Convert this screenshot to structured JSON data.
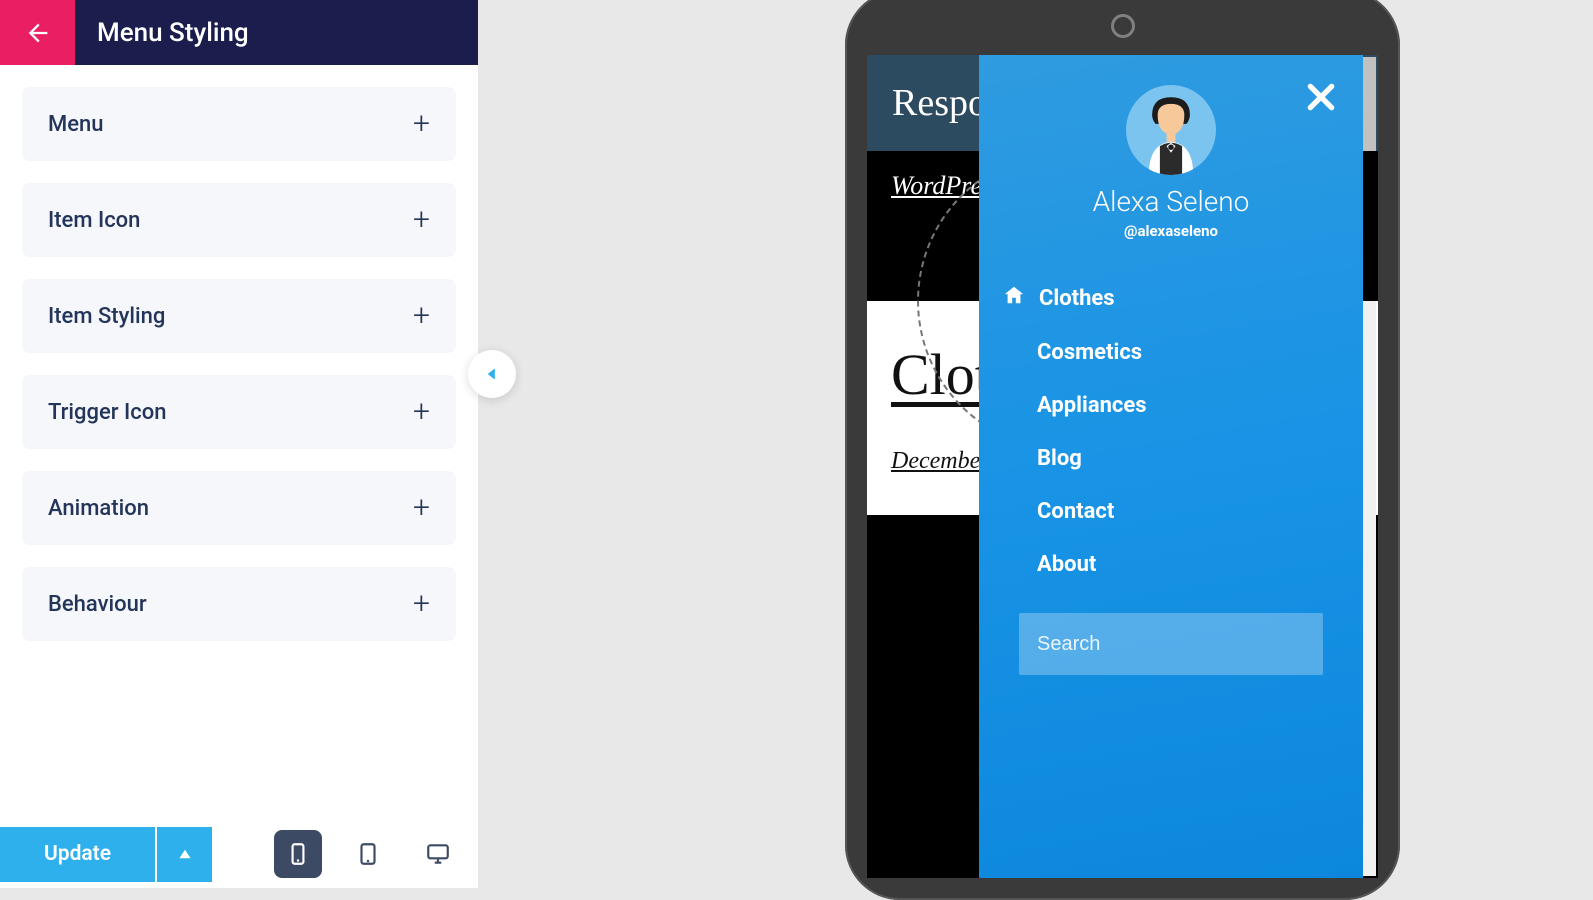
{
  "panel": {
    "title": "Menu Styling",
    "sections": [
      {
        "label": "Menu"
      },
      {
        "label": "Item Icon"
      },
      {
        "label": "Item Styling"
      },
      {
        "label": "Trigger Icon"
      },
      {
        "label": "Animation"
      },
      {
        "label": "Behaviour"
      }
    ],
    "update_label": "Update"
  },
  "preview": {
    "site_title": "Respo",
    "hero_link": "WordPre",
    "body_heading": "Clot",
    "body_date": "December"
  },
  "menu": {
    "user_name": "Alexa Seleno",
    "user_handle": "@alexaseleno",
    "items": [
      {
        "label": "Clothes",
        "icon": "home"
      },
      {
        "label": "Cosmetics"
      },
      {
        "label": "Appliances"
      },
      {
        "label": "Blog"
      },
      {
        "label": "Contact"
      },
      {
        "label": "About"
      }
    ],
    "search_placeholder": "Search"
  }
}
